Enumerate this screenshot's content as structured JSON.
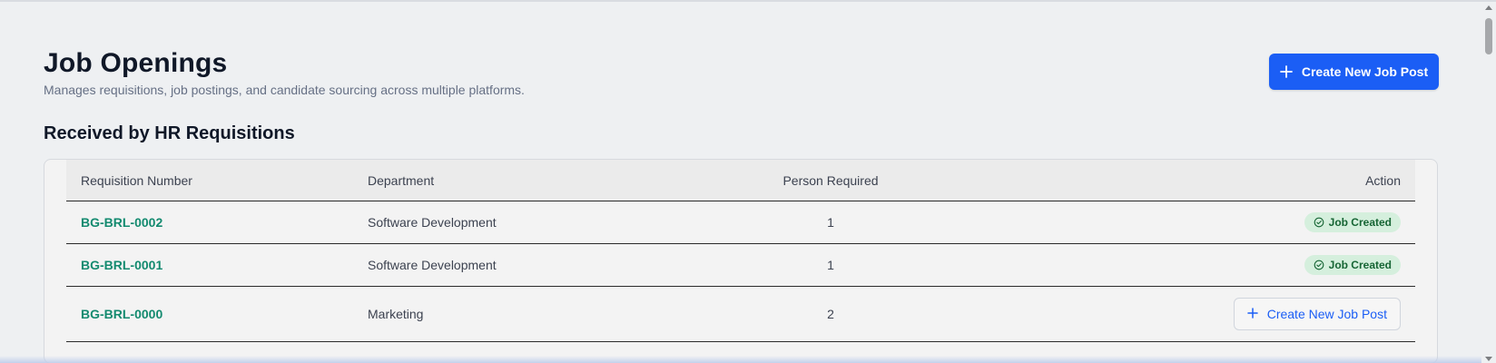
{
  "header": {
    "title": "Job Openings",
    "subtitle": "Manages requisitions, job postings, and candidate sourcing across multiple platforms.",
    "create_button_label": "Create New Job Post",
    "create_button_icon": "plus-icon"
  },
  "section": {
    "title": "Received by HR Requisitions"
  },
  "table": {
    "columns": [
      "Requisition Number",
      "Department",
      "Person Required",
      "Action"
    ],
    "rows": [
      {
        "requisition_number": "BG-BRL-0002",
        "department": "Software Development",
        "person_required": "1",
        "action": "Job Created",
        "action_type": "badge"
      },
      {
        "requisition_number": "BG-BRL-0001",
        "department": "Software Development",
        "person_required": "1",
        "action": "Job Created",
        "action_type": "badge"
      },
      {
        "requisition_number": "BG-BRL-0000",
        "department": "Marketing",
        "person_required": "2",
        "action": "Create New Job Post",
        "action_type": "button"
      }
    ]
  },
  "colors": {
    "primary": "#1b5ef5",
    "link": "#138a6f",
    "badge_bg": "#d5efdd",
    "badge_text": "#166534"
  }
}
